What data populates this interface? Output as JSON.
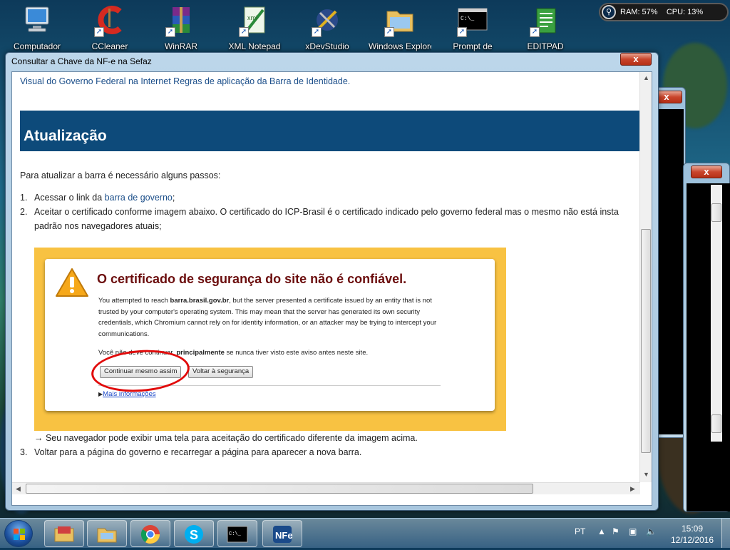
{
  "desktop": {
    "icons": [
      {
        "label": "Computador",
        "icon": "computer-icon"
      },
      {
        "label": "CCleaner",
        "icon": "ccleaner-icon"
      },
      {
        "label": "WinRAR",
        "icon": "winrar-icon"
      },
      {
        "label": "XML Notepad",
        "icon": "xml-notepad-icon"
      },
      {
        "label": "xDevStudio",
        "icon": "xdevstudio-icon"
      },
      {
        "label": "Windows Explorer",
        "icon": "folder-icon"
      },
      {
        "label": "Prompt de",
        "icon": "cmd-icon"
      },
      {
        "label": "EDITPAD",
        "icon": "editpad-icon"
      }
    ],
    "system_monitor": {
      "ram": "RAM: 57%",
      "cpu": "CPU: 13%"
    }
  },
  "window": {
    "title": "Consultar a Chave da NF-e na Sefaz",
    "close_label": "x"
  },
  "page": {
    "intro_line": "Visual do Governo Federal na Internet Regras de aplicação da Barra de Identidade.",
    "heading": "Atualização",
    "lead": "Para atualizar a barra é necessário alguns passos:",
    "steps": [
      {
        "num": "1.",
        "text_before": "Acessar o link da ",
        "link": "barra de governo",
        "text_after": ";"
      },
      {
        "num": "2.",
        "line1": "Aceitar o certificado conforme imagem abaixo. O certificado do ICP-Brasil é o certificado indicado pelo governo federal mas o mesmo não está insta",
        "line2": "padrão nos navegadores atuais;"
      },
      {
        "num": "3.",
        "text": "Voltar para a página do governo e recarregar a página para aparecer a nova barra."
      }
    ],
    "arrow_note": "→ Seu navegador pode exibir uma tela para aceitação do certificado diferente da imagem acima.",
    "certificate": {
      "heading": "O certificado de segurança do site não é confiável.",
      "body_prefix": "You attempted to reach ",
      "body_host": "barra.brasil.gov.br",
      "body_rest": ", but the server presented a certificate issued by an entity that is not trusted by your computer's operating system. This may mean that the server has generated its own security credentials, which Chromium cannot rely on for identity information, or an attacker may be trying to intercept your communications.",
      "note_prefix": "Você não deve continuar, ",
      "note_bold": "principalmente",
      "note_suffix": " se nunca tiver visto este aviso antes neste site.",
      "proceed_button": "Continuar mesmo assim",
      "back_button": "Voltar à segurança",
      "more_link": "Mais informações",
      "box_color": "#f8c242",
      "highlight_color": "#e10a0a"
    }
  },
  "taskbar": {
    "pinned": [
      {
        "icon": "explorer-icon"
      },
      {
        "icon": "folder-icon"
      },
      {
        "icon": "chrome-icon"
      },
      {
        "icon": "skype-icon"
      },
      {
        "icon": "cmd-icon"
      },
      {
        "icon": "nfe-icon"
      }
    ],
    "language": "PT",
    "time": "15:09",
    "date": "12/12/2016"
  },
  "colors": {
    "banner": "#0d4a7a",
    "link": "#1c4f8a",
    "cert_heading": "#6b0d0d"
  }
}
